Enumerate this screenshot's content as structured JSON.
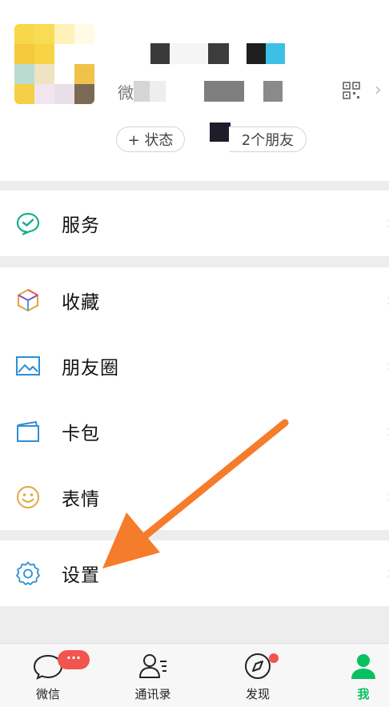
{
  "profile": {
    "wechat_id_prefix": "微",
    "status_button": "+ 状态",
    "friends_button": "2个朋友"
  },
  "menu": {
    "services": "服务",
    "favorites": "收藏",
    "moments": "朋友圈",
    "cards": "卡包",
    "stickers": "表情",
    "settings": "设置"
  },
  "tabs": {
    "chats": "微信",
    "contacts": "通讯录",
    "discover": "发现",
    "me": "我",
    "chats_badge": "···"
  },
  "colors": {
    "accent": "#07c160",
    "arrow": "#f57c2b",
    "badge": "#f25450"
  }
}
